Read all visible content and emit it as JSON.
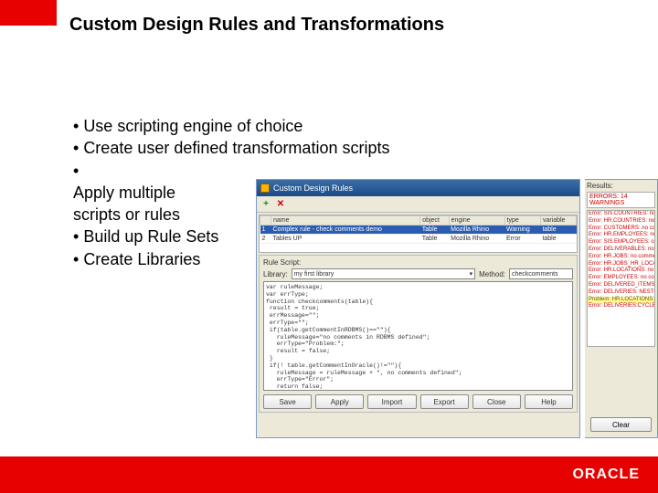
{
  "slide": {
    "title": "Custom Design Rules and Transformations",
    "bullets": {
      "b1": "Use scripting engine of choice",
      "b2": "Create user defined transformation scripts",
      "b3a": "Apply multiple",
      "b3b": "scripts or rules",
      "b4": "Build up Rule Sets",
      "b5": "Create Libraries"
    },
    "logo": "ORACLE"
  },
  "window": {
    "title": "Custom Design Rules",
    "table": {
      "headers": {
        "h1": "name",
        "h2": "object",
        "h3": "engine",
        "h4": "type",
        "h5": "variable"
      },
      "row1": {
        "c1": "Complex rule - check comments demo",
        "c2": "Table",
        "c3": "Mozilla Rhino",
        "c4": "Warning",
        "c5": "table"
      },
      "row2": {
        "c1": "Tables UP",
        "c2": "Table",
        "c3": "Mozilla Rhino",
        "c4": "Error",
        "c5": "table"
      }
    },
    "ruleScript": {
      "sectionLabel": "Rule Script:",
      "libraryLabel": "Library:",
      "libraryValue": "my first library",
      "methodLabel": "Method:",
      "methodValue": "checkcomments",
      "code": "var ruleMessage;\nvar errType;\nfunction checkcomments(table){\n result = true;\n errMessage=\"\";\n errType=\"\";\n if(table.getCommentInRDBMS()==\"\"){\n   ruleMessage=\"no comments in RDBMS defined\";\n   errType=\"Problem:\";\n   result = false;\n }\n if(! table.getCommentInOracle()!=\"\"){\n   ruleMessage = ruleMessage + \", no comments defined\";\n   errType=\"Error\";\n   return false;\n }\n return result;\n}"
    },
    "buttons": {
      "save": "Save",
      "apply": "Apply",
      "import": "Import",
      "export": "Export",
      "close": "Close",
      "help": "Help"
    }
  },
  "results": {
    "header": "Results:",
    "count": "ERRORS: 14",
    "countSuffix": "WARNINGS",
    "items": [
      "Error: SIS.COUNTRIES: no",
      "Error: HR.COUNTRIES: no c",
      "Error: CUSTOMERS: no comm",
      "Error: HR.EMPLOYEES: no c",
      "Error: SIS.EMPLOYEES: com",
      "Error: DELIVERABLES: no",
      "Error: HR.JOBS: no comme",
      "Error: HR.JOBS_HR_LOCAT",
      "Error: HR.LOCATIONS: no",
      "Error: EMPLOYEES: no com",
      "Error: DELIVERED_ITEMS: n",
      "Error: DELIVERIES: NESTED"
    ],
    "warnItem": "Problem: HR.LOCATIONS: no co",
    "lastErr": "Error: DELIVERIES:CYCLE: no",
    "clear": "Clear"
  }
}
